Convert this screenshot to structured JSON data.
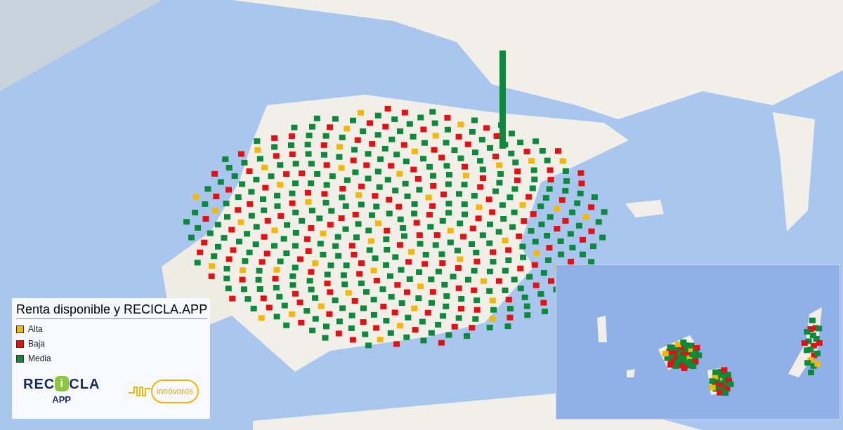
{
  "legend": {
    "title": "Renta disponible y RECICLA.APP",
    "items": [
      {
        "label": "Alta",
        "color": "#f5b800"
      },
      {
        "label": "Baja",
        "color": "#e51010"
      },
      {
        "label": "Media",
        "color": "#0a8a3a"
      }
    ],
    "logos": {
      "recicla": {
        "word_left": "REC",
        "word_mid": "i",
        "word_right": "CLA",
        "sub": "APP"
      },
      "innovoros": "innóvoros"
    }
  }
}
